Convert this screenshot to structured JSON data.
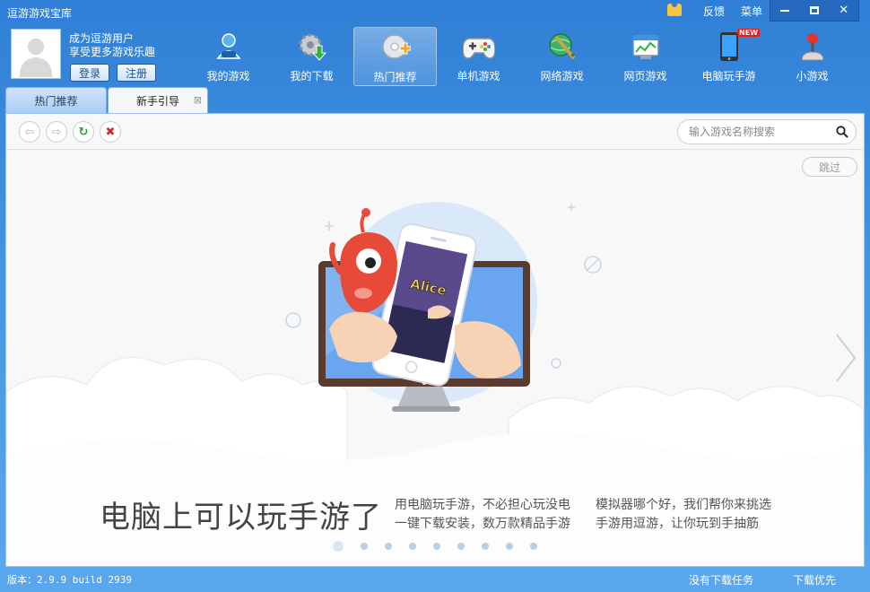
{
  "window": {
    "title": "逗游游戏宝库",
    "feedback_label": "反馈",
    "menu_label": "菜单"
  },
  "user": {
    "line1": "成为逗游用户",
    "line2": "享受更多游戏乐趣",
    "login_label": "登录",
    "register_label": "注册"
  },
  "nav": {
    "items": [
      {
        "label": "我的游戏",
        "icon": "user-gamepad-icon"
      },
      {
        "label": "我的下载",
        "icon": "gear-download-icon"
      },
      {
        "label": "热门推荐",
        "icon": "disc-plus-icon"
      },
      {
        "label": "单机游戏",
        "icon": "gamepad-icon"
      },
      {
        "label": "网络游戏",
        "icon": "globe-sword-icon"
      },
      {
        "label": "网页游戏",
        "icon": "browser-chart-icon"
      },
      {
        "label": "电脑玩手游",
        "icon": "phone-icon",
        "badge": "NEW"
      },
      {
        "label": "小游戏",
        "icon": "joystick-icon"
      }
    ],
    "active_index": 2
  },
  "tabs": [
    {
      "label": "热门推荐"
    },
    {
      "label": "新手引导"
    }
  ],
  "toolbar": {
    "search_placeholder": "输入游戏名称搜索"
  },
  "guide": {
    "skip_label": "跳过",
    "headline": "电脑上可以玩手游了",
    "desc1_line1": "用电脑玩手游，不必担心玩没电",
    "desc1_line2": "一键下载安装，数万款精品手游",
    "desc2_line1": "模拟器哪个好，我们帮你来挑选",
    "desc2_line2": "手游用逗游，让你玩到手抽筋",
    "phone_game_title": "Alice",
    "page_count": 9,
    "current_page": 1
  },
  "status": {
    "version": "版本：2.9.9 build 2939",
    "tasks": "没有下载任务",
    "priority": "下载优先"
  },
  "colors": {
    "accent": "#3b8fe0",
    "brand_red": "#e84a3a"
  }
}
